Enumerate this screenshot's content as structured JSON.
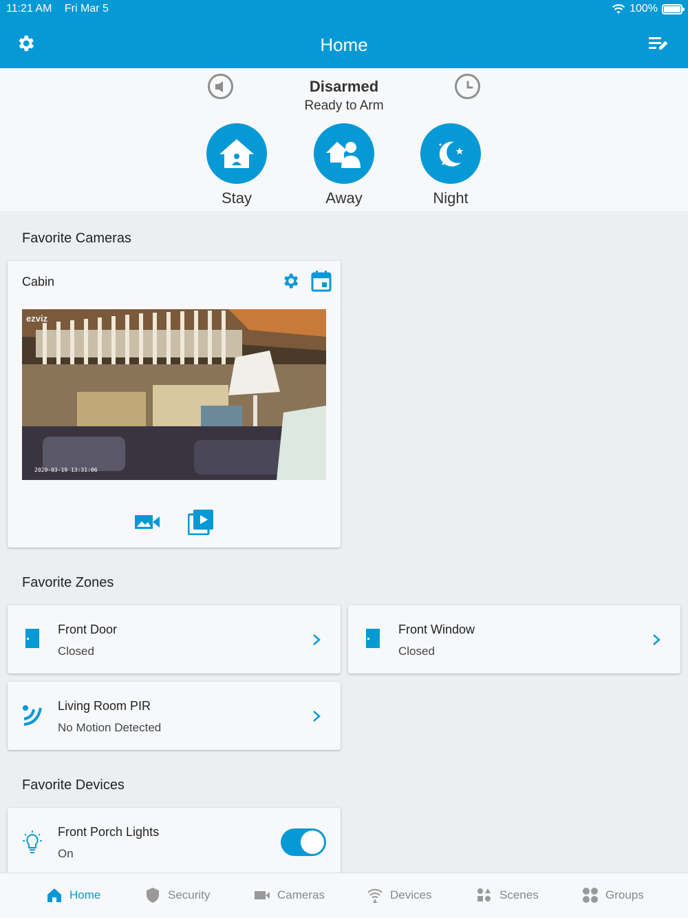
{
  "status_bar": {
    "time": "11:21 AM",
    "date": "Fri Mar 5",
    "battery": "100%"
  },
  "header": {
    "title": "Home"
  },
  "arm": {
    "status": "Disarmed",
    "substatus": "Ready to Arm",
    "modes": [
      {
        "label": "Stay"
      },
      {
        "label": "Away"
      },
      {
        "label": "Night"
      }
    ]
  },
  "cameras": {
    "section_title": "Favorite Cameras",
    "items": [
      {
        "name": "Cabin",
        "watermark": "ezviz",
        "timestamp": "2020-03-19 13:31:06"
      }
    ]
  },
  "zones": {
    "section_title": "Favorite Zones",
    "items": [
      {
        "name": "Front Door",
        "status": "Closed"
      },
      {
        "name": "Front Window",
        "status": "Closed"
      },
      {
        "name": "Living Room PIR",
        "status": "No Motion Detected"
      }
    ]
  },
  "devices": {
    "section_title": "Favorite Devices",
    "items": [
      {
        "name": "Front Porch Lights",
        "status": "On",
        "on": true
      }
    ]
  },
  "tabs": [
    {
      "label": "Home",
      "icon": "home-icon",
      "active": true
    },
    {
      "label": "Security",
      "icon": "shield-icon"
    },
    {
      "label": "Cameras",
      "icon": "camera-icon"
    },
    {
      "label": "Devices",
      "icon": "wifi-icon"
    },
    {
      "label": "Scenes",
      "icon": "scenes-icon"
    },
    {
      "label": "Groups",
      "icon": "groups-icon"
    }
  ],
  "colors": {
    "accent": "#0799d6",
    "background": "#eceef1",
    "card": "#f7f8fa"
  }
}
